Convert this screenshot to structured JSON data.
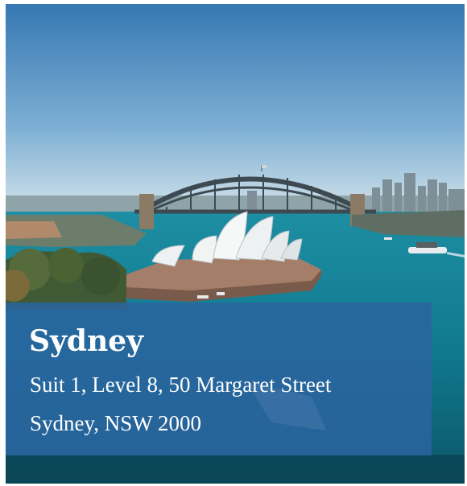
{
  "location": {
    "city": "Sydney",
    "address_line1": "Suit 1, Level 8, 50 Margaret Street",
    "address_line2": "Sydney, NSW 2000"
  },
  "photo": {
    "subject": "Sydney Harbour Bridge and Opera House",
    "colors": {
      "sky_top": "#3b7fb8",
      "sky_horizon": "#c9dbe6",
      "water": "#127f94",
      "panel": "#2a64a0"
    }
  }
}
